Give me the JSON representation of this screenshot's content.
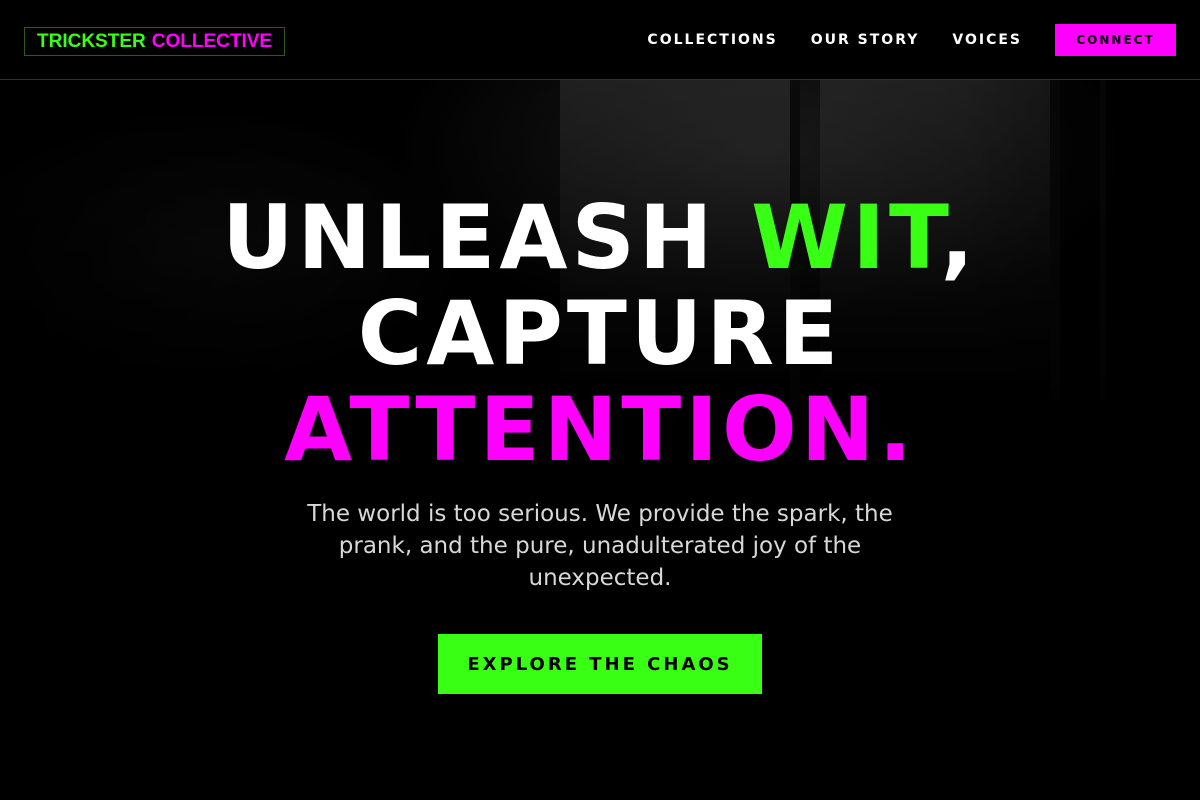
{
  "brand": {
    "name_part_1": "TRICKSTER",
    "name_part_2": "COLLECTIVE"
  },
  "nav": {
    "items": [
      {
        "label": "COLLECTIONS"
      },
      {
        "label": "OUR STORY"
      },
      {
        "label": "VOICES"
      }
    ],
    "cta_label": "CONNECT"
  },
  "hero": {
    "headline": {
      "line1_white": "UNLEASH",
      "line1_green": "WIT",
      "line1_comma": ",",
      "line2": "CAPTURE",
      "line3": "ATTENTION."
    },
    "subtitle": "The world is too serious. We provide the spark, the prank, and the pure, unadulterated joy of the unexpected.",
    "cta_label": "EXPLORE THE CHAOS"
  },
  "colors": {
    "background": "#000000",
    "accent_green": "#39ff14",
    "accent_pink": "#ff00ff",
    "text": "#ffffff",
    "subtitle_text": "#d8d8d8"
  }
}
